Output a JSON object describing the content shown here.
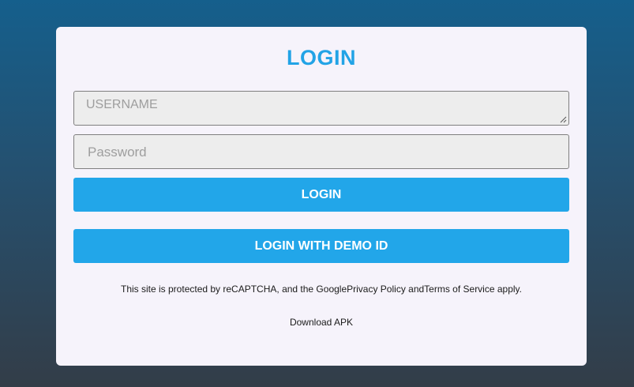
{
  "login_form": {
    "title": "LOGIN",
    "username_placeholder": "USERNAME",
    "password_placeholder": "Password",
    "login_button": "LOGIN",
    "demo_button": "LOGIN WITH DEMO ID",
    "recaptcha_notice": "This site is protected by reCAPTCHA, and the GooglePrivacy Policy andTerms of Service apply.",
    "download_apk": "Download APK"
  },
  "colors": {
    "accent": "#22a6e9",
    "card_background": "#f6f3fb",
    "input_background": "#ededed",
    "page_gradient_top": "#155f8c",
    "page_gradient_bottom": "#333d48"
  },
  "icons": {
    "textarea_resize": "resize-grip-icon"
  }
}
